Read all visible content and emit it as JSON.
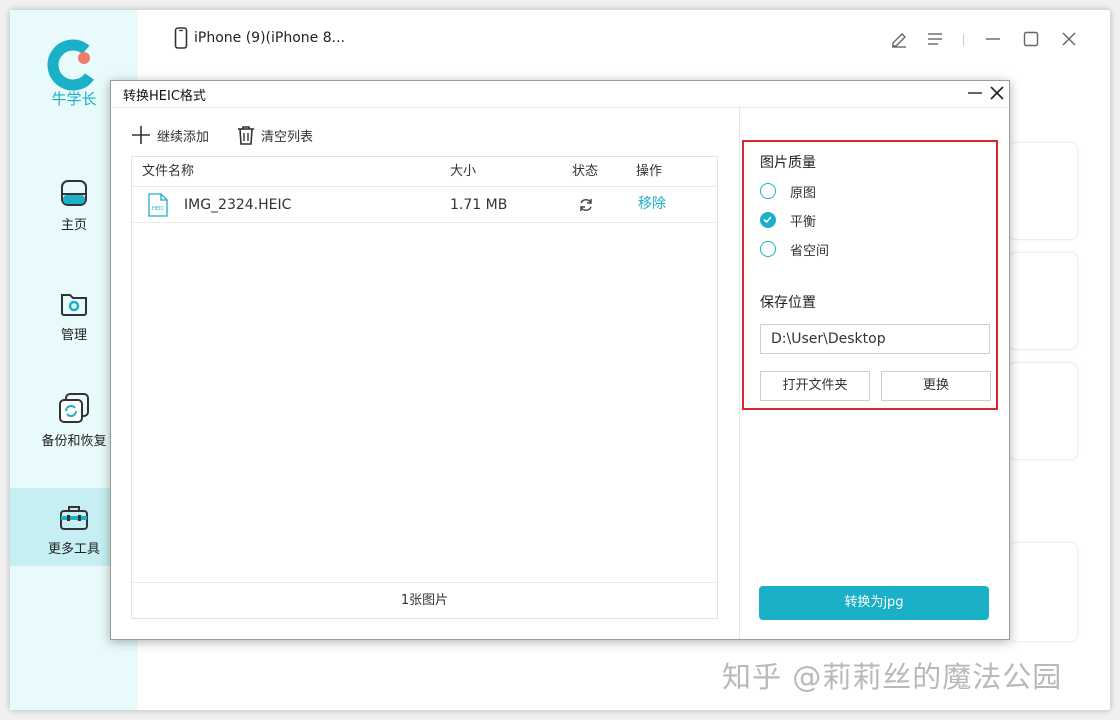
{
  "app": {
    "brand": "牛学长",
    "device_name": "iPhone (9)(iPhone 8...",
    "accent_color": "#1ab0c8",
    "nav": [
      {
        "label": "主页",
        "icon": "home-icon"
      },
      {
        "label": "管理",
        "icon": "folder-gear-icon"
      },
      {
        "label": "备份和恢复",
        "icon": "backup-restore-icon"
      },
      {
        "label": "更多工具",
        "icon": "toolbox-icon",
        "active": true
      }
    ],
    "window_controls": [
      "edit-icon",
      "menu-icon",
      "minimize-icon",
      "maximize-icon",
      "close-icon"
    ]
  },
  "dialog": {
    "title": "转换HEIC格式",
    "toolbar": {
      "add_label": "继续添加",
      "clear_label": "清空列表"
    },
    "table": {
      "headers": [
        "文件名称",
        "大小",
        "状态",
        "操作"
      ],
      "rows": [
        {
          "file_type": "HEIC",
          "name": "IMG_2324.HEIC",
          "size": "1.71 MB",
          "status_icon": "refresh-icon",
          "action": "移除"
        }
      ],
      "footer": "1张图片"
    },
    "settings": {
      "quality_title": "图片质量",
      "quality_options": [
        "原图",
        "平衡",
        "省空间"
      ],
      "quality_selected": "平衡",
      "save_title": "保存位置",
      "save_path": "D:\\User\\Desktop",
      "open_folder_label": "打开文件夹",
      "change_label": "更换",
      "highlight_color": "#d9272e"
    },
    "convert_label": "转换为jpg"
  },
  "watermark": "知乎 @莉莉丝的魔法公园"
}
